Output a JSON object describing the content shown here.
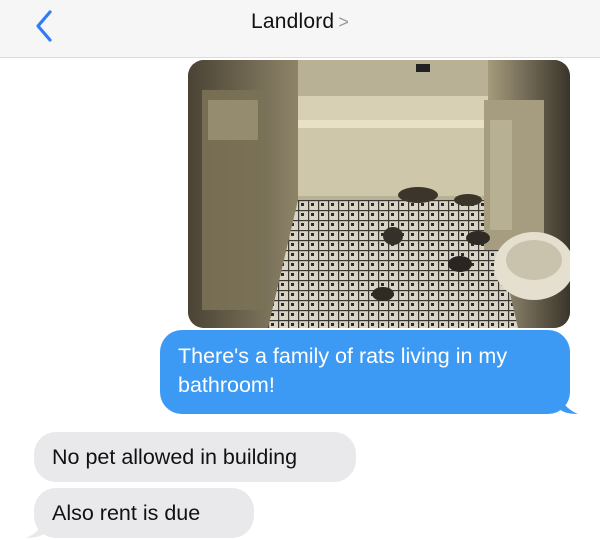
{
  "header": {
    "contact_name": "Landlord",
    "contact_chevron": ">",
    "back_icon": "chevron-left-icon"
  },
  "colors": {
    "accent": "#2f7cf6",
    "outgoing_bubble": "#3c9af5",
    "incoming_bubble": "#e9e9eb"
  },
  "messages": [
    {
      "direction": "outgoing",
      "type": "photo",
      "subject": "bathroom with rats on tiled floor"
    },
    {
      "direction": "outgoing",
      "type": "text",
      "text": "There's a family of rats living in my bathroom!"
    },
    {
      "direction": "incoming",
      "type": "text",
      "text": "No pet allowed in building"
    },
    {
      "direction": "incoming",
      "type": "text",
      "text": "Also rent is due"
    }
  ]
}
